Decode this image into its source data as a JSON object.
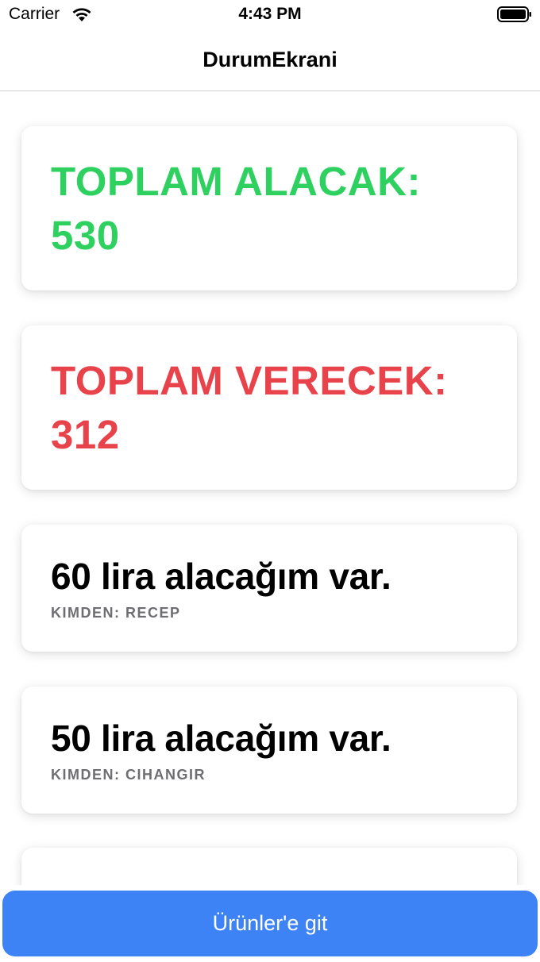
{
  "status_bar": {
    "carrier": "Carrier",
    "time": "4:43 PM"
  },
  "nav": {
    "title": "DurumEkrani"
  },
  "summary": {
    "receivable_label": "TOPLAM ALACAK:",
    "receivable_value": "530",
    "payable_label": "TOPLAM VERECEK:",
    "payable_value": "312"
  },
  "entries": [
    {
      "text": "60 lira alacağım var.",
      "from": "KIMDEN: RECEP"
    },
    {
      "text": "50 lira alacağım var.",
      "from": "KIMDEN: CIHANGIR"
    },
    {
      "text": "",
      "from": ""
    }
  ],
  "footer": {
    "button_label": "Ürünler'e git"
  },
  "colors": {
    "receivable": "#2ed15f",
    "payable": "#e8424a",
    "accent": "#3e83f5"
  },
  "icons": [
    "wifi-icon",
    "battery-icon"
  ]
}
